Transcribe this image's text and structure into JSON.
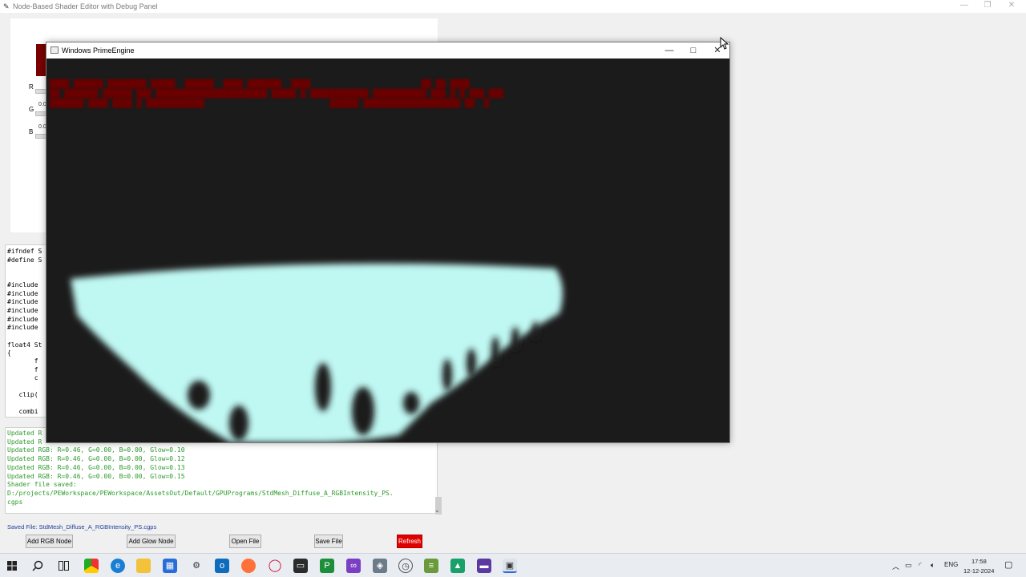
{
  "main_window": {
    "title": "Node-Based Shader Editor with Debug Panel",
    "controls": {
      "minimize": "—",
      "maximize": "❐",
      "close": "✕"
    }
  },
  "color_panel": {
    "swatch_color": "#7a0000",
    "sliders": [
      {
        "label": "R",
        "value": ""
      },
      {
        "label": "G",
        "value": "0.0"
      },
      {
        "label": "B",
        "value": "0.0"
      }
    ]
  },
  "code_lines": [
    "#ifndef S",
    "#define S",
    "",
    "#include",
    "#include",
    "#include",
    "#include",
    "#include",
    "#include",
    "",
    "",
    "float4 St",
    "{",
    "       f",
    "       f",
    "       c",
    "",
    "   clip(",
    "",
    "   combi"
  ],
  "log_lines": [
    "Updated R",
    "Updated R",
    "Updated RGB: R=0.46, G=0.00, B=0.00, Glow=0.10",
    "Updated RGB: R=0.46, G=0.00, B=0.00, Glow=0.12",
    "Updated RGB: R=0.46, G=0.00, B=0.00, Glow=0.13",
    "Updated RGB: R=0.46, G=0.00, B=0.00, Glow=0.15",
    "Shader file saved:",
    "D:/projects/PEWorkspace/PEWorkspace/AssetsOut/Default/GPUPrograms/StdMesh_Diffuse_A_RGBIntensity_PS.",
    "cgps"
  ],
  "status": "Saved File: StdMesh_Diffuse_A_RGBIntensity_PS.cgps",
  "buttons": {
    "add_rgb": "Add RGB Node",
    "add_glow": "Add Glow Node",
    "open_file": "Open File",
    "save_file": "Save File",
    "refresh": "Refresh"
  },
  "engine_window": {
    "title": "Windows PrimeEngine",
    "controls": {
      "minimize": "—",
      "maximize": "□",
      "close": "✕"
    }
  },
  "taskbar": {
    "language": "ENG",
    "time": "17:58",
    "date": "12-12-2024"
  }
}
